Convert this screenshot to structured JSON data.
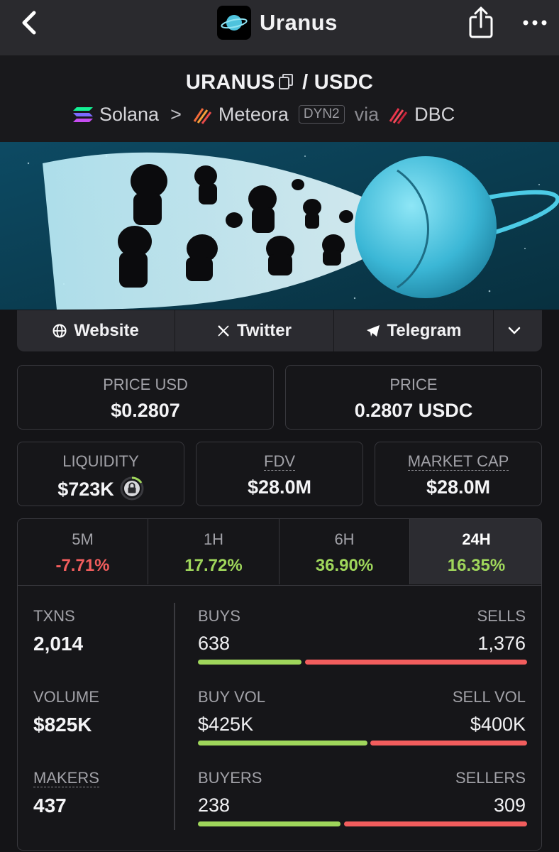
{
  "app": {
    "title": "Uranus"
  },
  "header": {
    "base_token": "URANUS",
    "pair_sep": "/",
    "quote_token": "USDC",
    "chain": "Solana",
    "chevron": ">",
    "dex": "Meteora",
    "dex_badge": "DYN2",
    "via": "via",
    "launchpad": "DBC"
  },
  "links": {
    "website": "Website",
    "twitter": "Twitter",
    "telegram": "Telegram"
  },
  "price_cards": {
    "price_usd_label": "PRICE USD",
    "price_usd": "$0.2807",
    "price_label": "PRICE",
    "price": "0.2807 USDC"
  },
  "metric_cards": {
    "liquidity_label": "LIQUIDITY",
    "liquidity": "$723K",
    "fdv_label": "FDV",
    "fdv": "$28.0M",
    "mcap_label": "MARKET CAP",
    "mcap": "$28.0M"
  },
  "timeframes": [
    {
      "name": "5M",
      "change": "-7.71%"
    },
    {
      "name": "1H",
      "change": "17.72%"
    },
    {
      "name": "6H",
      "change": "36.90%"
    },
    {
      "name": "24H",
      "change": "16.35%"
    }
  ],
  "selected_timeframe": "24H",
  "stats": {
    "txns_label": "TXNS",
    "txns": "2,014",
    "volume_label": "VOLUME",
    "volume": "$825K",
    "makers_label": "MAKERS",
    "makers": "437",
    "buys_label": "BUYS",
    "buys": "638",
    "sells_label": "SELLS",
    "sells": "1,376",
    "buy_vol_label": "BUY VOL",
    "buy_vol": "$425K",
    "sell_vol_label": "SELL VOL",
    "sell_vol": "$400K",
    "buyers_label": "BUYERS",
    "buyers": "238",
    "sellers_label": "SELLERS",
    "sellers": "309"
  },
  "colors": {
    "positive": "#9fd65b",
    "negative": "#f25d5d",
    "background": "#141417"
  },
  "icons": [
    "back-chevron-icon",
    "share-icon",
    "more-dots-icon",
    "copy-icon",
    "solana-icon",
    "meteora-icon",
    "dbc-icon",
    "globe-icon",
    "x-icon",
    "telegram-icon",
    "chevron-down-icon",
    "lock-icon"
  ]
}
